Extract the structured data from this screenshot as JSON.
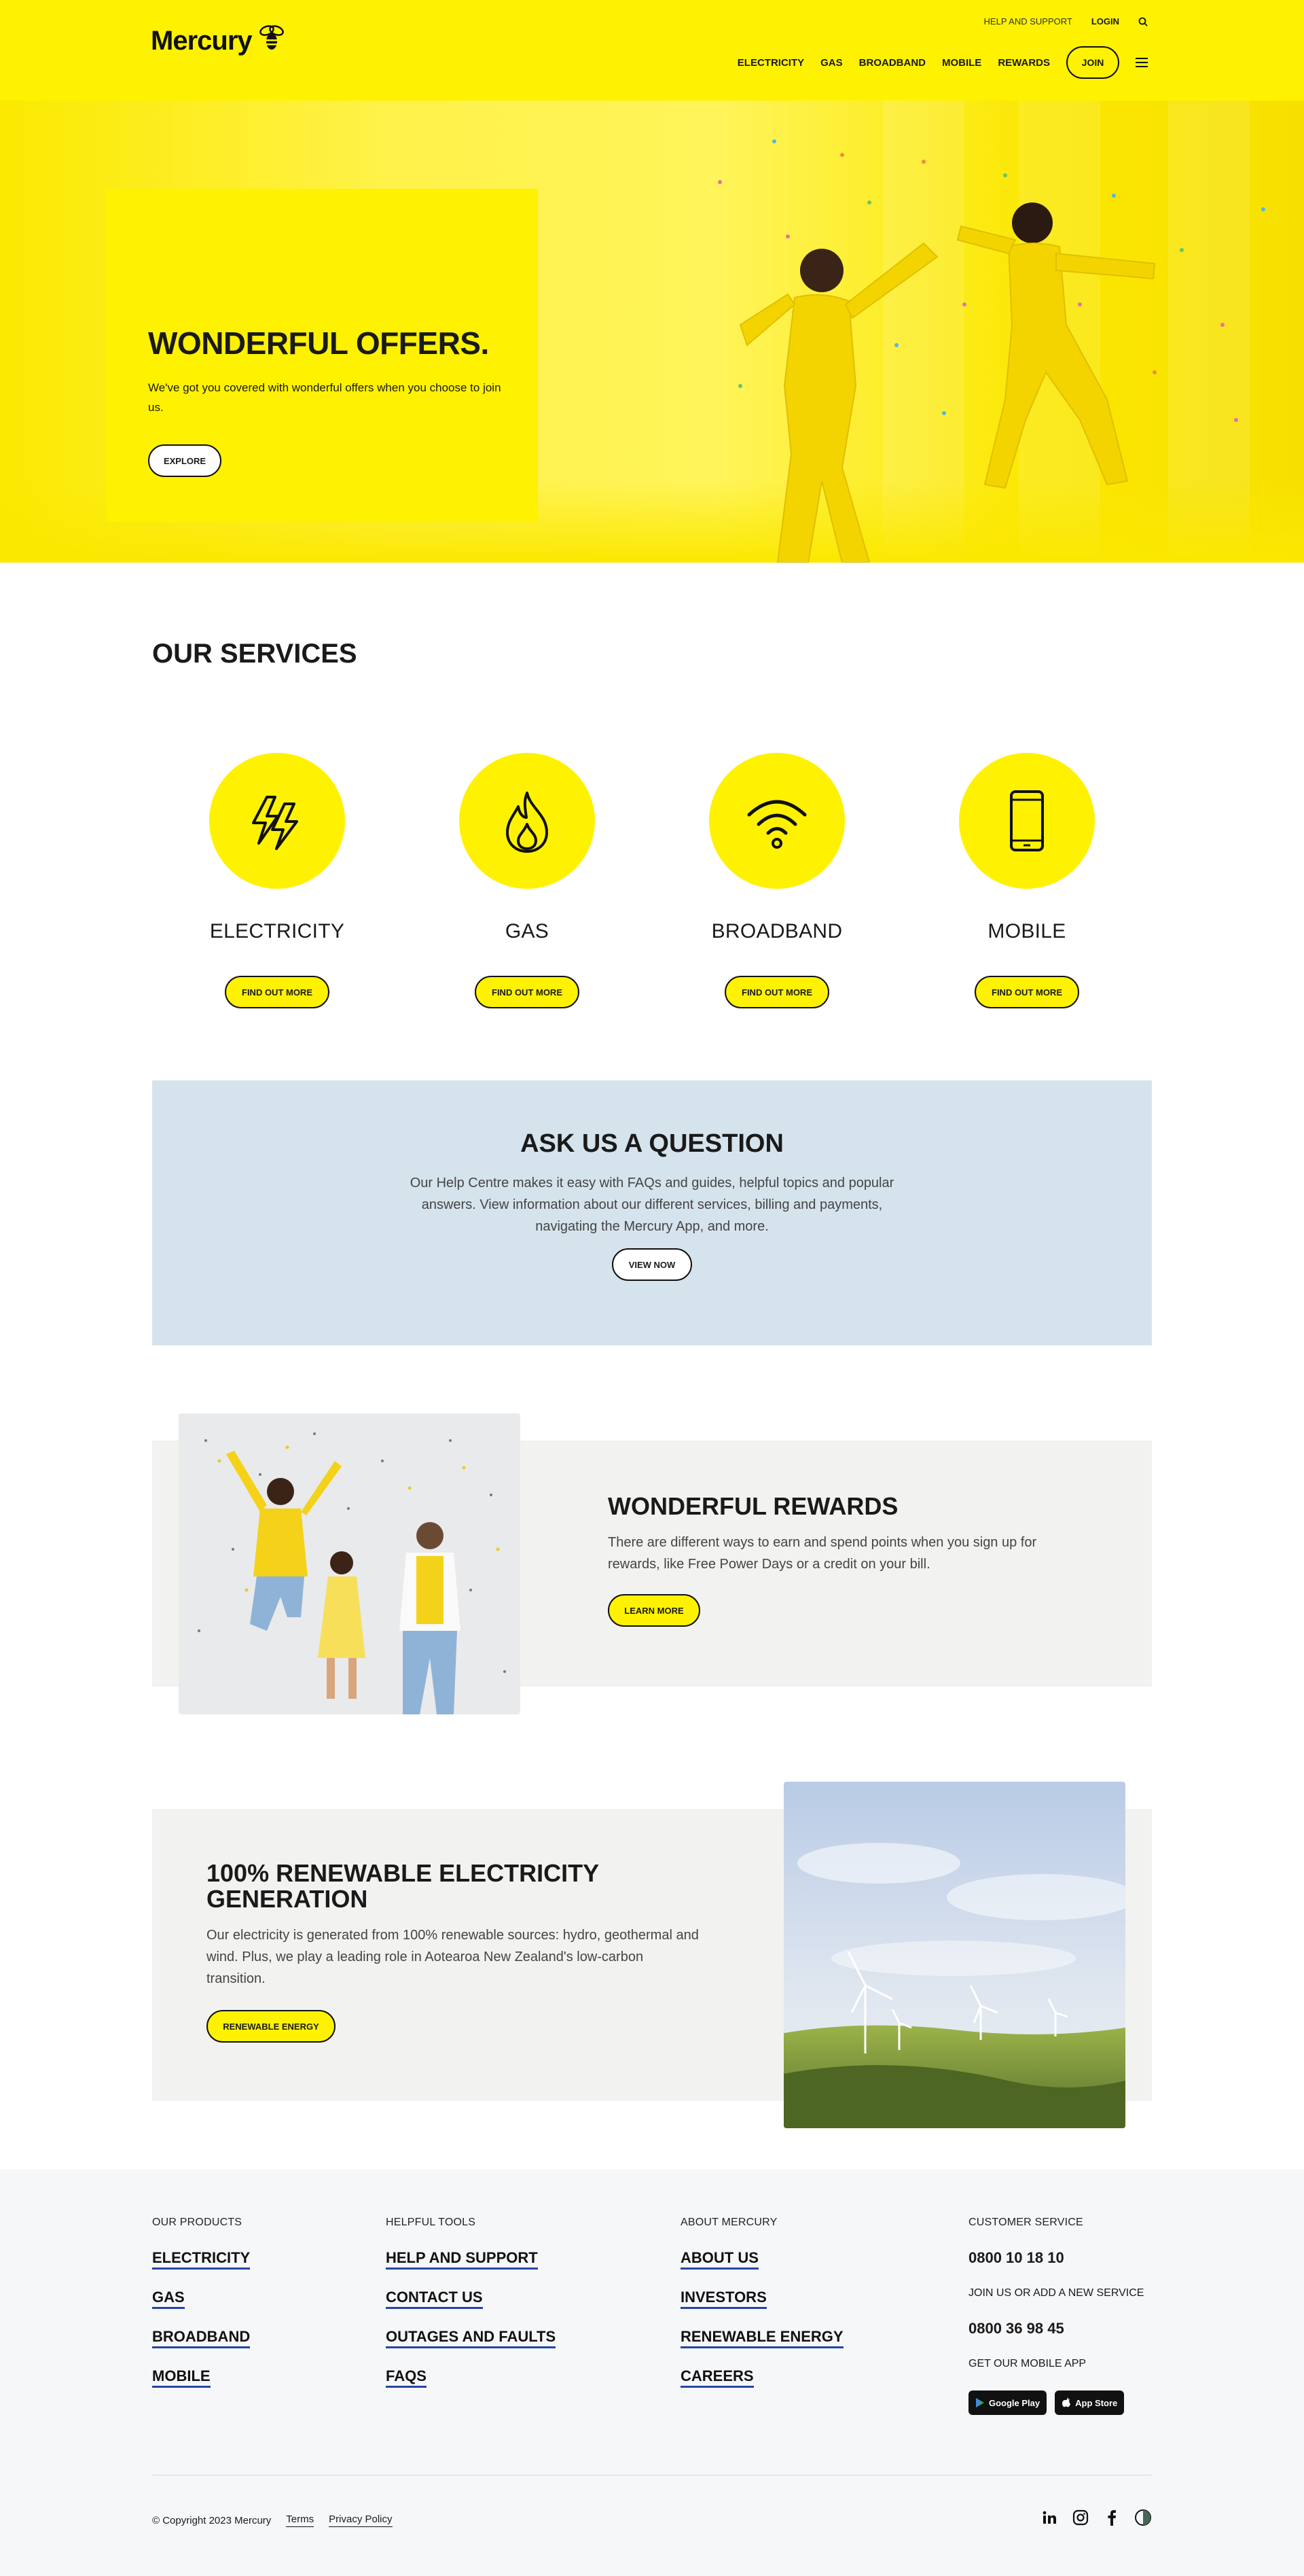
{
  "header": {
    "logo_text": "Mercury",
    "util_nav": {
      "help": "HELP AND SUPPORT",
      "login": "LOGIN"
    },
    "main_nav": [
      "ELECTRICITY",
      "GAS",
      "BROADBAND",
      "MOBILE",
      "REWARDS"
    ],
    "join_label": "JOIN"
  },
  "hero": {
    "title": "WONDERFUL OFFERS.",
    "text": "We've got you covered with wonderful offers when you choose to join us.",
    "button": "EXPLORE"
  },
  "services": {
    "title": "OUR SERVICES",
    "items": [
      {
        "label": "ELECTRICITY",
        "button": "FIND OUT MORE",
        "icon": "lightning-icon"
      },
      {
        "label": "GAS",
        "button": "FIND OUT MORE",
        "icon": "flame-icon"
      },
      {
        "label": "BROADBAND",
        "button": "FIND OUT MORE",
        "icon": "wifi-icon"
      },
      {
        "label": "MOBILE",
        "button": "FIND OUT MORE",
        "icon": "phone-icon"
      }
    ]
  },
  "ask": {
    "title": "ASK US A QUESTION",
    "text": "Our Help Centre makes it easy with FAQs and guides, helpful topics and popular answers. View information about our different services, billing and payments, navigating the Mercury App, and more.",
    "button": "VIEW NOW"
  },
  "rewards": {
    "title": "WONDERFUL REWARDS",
    "text": "There are different ways to earn and spend points when you sign up for rewards, like Free Power Days or a credit on your bill.",
    "button": "LEARN MORE"
  },
  "renewable": {
    "title": "100% RENEWABLE ELECTRICITY GENERATION",
    "text": "Our electricity is generated from 100% renewable sources: hydro, geothermal and wind. Plus, we play a leading role in Aotearoa New Zealand's low-carbon transition.",
    "button": "RENEWABLE ENERGY"
  },
  "footer": {
    "products": {
      "heading": "OUR PRODUCTS",
      "links": [
        "ELECTRICITY",
        "GAS",
        "BROADBAND",
        "MOBILE"
      ]
    },
    "tools": {
      "heading": "HELPFUL TOOLS",
      "links": [
        "HELP AND SUPPORT",
        "CONTACT US",
        "OUTAGES AND FAULTS",
        "FAQS"
      ]
    },
    "about": {
      "heading": "ABOUT MERCURY",
      "links": [
        "ABOUT US",
        "INVESTORS",
        "RENEWABLE ENERGY",
        "CAREERS"
      ]
    },
    "customer_service": {
      "heading": "CUSTOMER SERVICE",
      "phone1": "0800 10 18 10",
      "join_text": "JOIN US OR ADD A NEW SERVICE",
      "phone2": "0800 36 98 45",
      "app_text": "GET OUR MOBILE APP",
      "google_play": "Google Play",
      "app_store": "App Store"
    },
    "copyright": "© Copyright 2023 Mercury",
    "terms": "Terms",
    "privacy": "Privacy Policy"
  },
  "colors": {
    "brand_yellow": "#fff200",
    "ask_bg": "#d5e3ec",
    "link_underline": "#2346a6"
  }
}
